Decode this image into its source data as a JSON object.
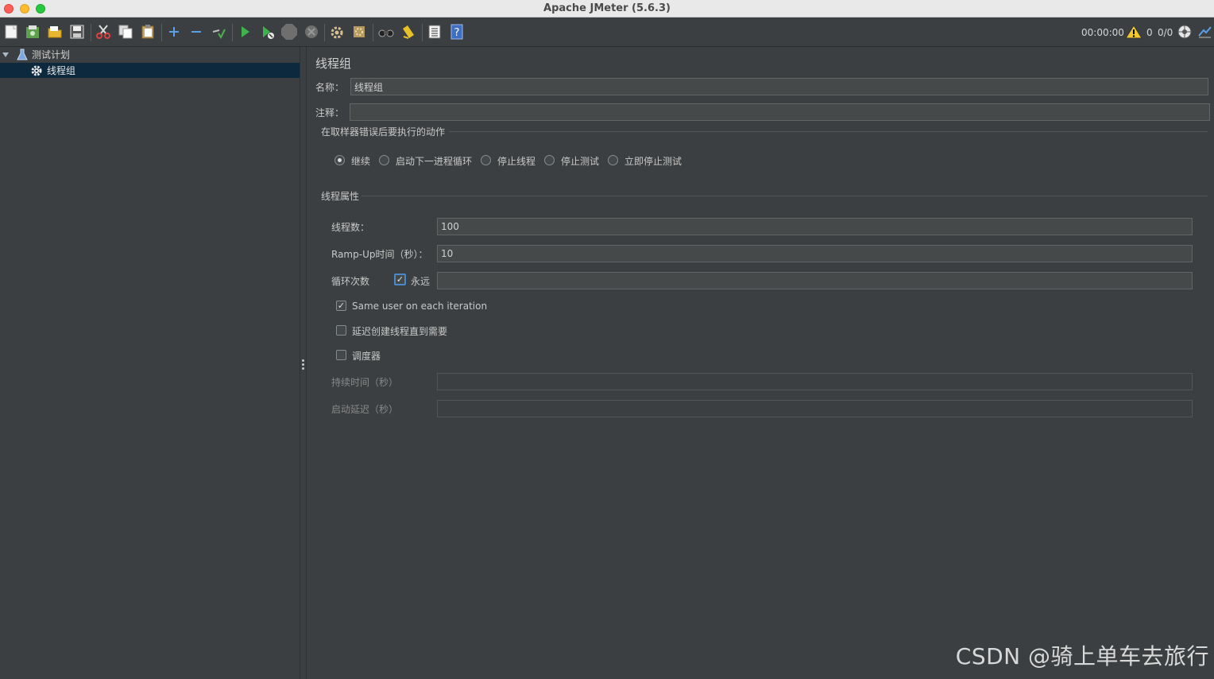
{
  "window": {
    "title": "Apache JMeter (5.6.3)"
  },
  "toolbar": {
    "icons": [
      "new-icon",
      "templates-icon",
      "open-icon",
      "save-icon",
      "cut-icon",
      "copy-icon",
      "paste-icon",
      "expand-icon",
      "collapse-icon",
      "toggle-icon",
      "start-icon",
      "start-no-pause-icon",
      "stop-icon",
      "shutdown-icon",
      "clear-icon",
      "clear-all-icon",
      "search-icon",
      "reset-search-icon",
      "function-helper-icon",
      "help-icon"
    ],
    "timer": "00:00:00",
    "warning_count": "0",
    "threads": "0/0"
  },
  "tree": {
    "items": [
      {
        "label": "测试计划",
        "icon": "flask-icon",
        "expanded": true
      },
      {
        "label": "线程组",
        "icon": "gear-icon",
        "selected": true
      }
    ]
  },
  "panel": {
    "title": "线程组",
    "name_label": "名称：",
    "name_value": "线程组",
    "comment_label": "注释：",
    "comment_value": "",
    "on_error": {
      "title": "在取样器错误后要执行的动作",
      "options": [
        "继续",
        "启动下一进程循环",
        "停止线程",
        "停止测试",
        "立即停止测试"
      ],
      "selected": "继续"
    },
    "thread_props": {
      "title": "线程属性",
      "threads_label": "线程数：",
      "threads_value": "100",
      "rampup_label": "Ramp-Up时间（秒）：",
      "rampup_value": "10",
      "loop_label": "循环次数",
      "forever_label": "永远",
      "forever_checked": true,
      "loop_value": "",
      "same_user_label": "Same user on each iteration",
      "same_user_checked": true,
      "delay_label": "延迟创建线程直到需要",
      "delay_checked": false,
      "scheduler_label": "调度器",
      "scheduler_checked": false,
      "duration_label": "持续时间（秒）",
      "duration_value": "",
      "startup_delay_label": "启动延迟（秒）",
      "startup_delay_value": ""
    }
  },
  "watermark": "CSDN @骑上单车去旅行"
}
